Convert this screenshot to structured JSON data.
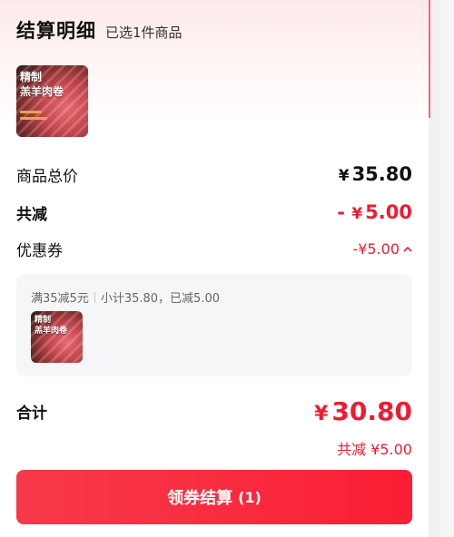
{
  "header": {
    "title": "结算明细",
    "subtitle": "已选1件商品"
  },
  "product": {
    "image_text_line1": "精制",
    "image_text_line2": "羔羊肉卷"
  },
  "summary": {
    "goods_total_label": "商品总价",
    "goods_total_currency": "¥",
    "goods_total_value": "35.80",
    "total_discount_label": "共减",
    "total_discount_prefix": "-",
    "total_discount_currency": "¥",
    "total_discount_value": "5.00",
    "coupon_label": "优惠券",
    "coupon_value": "-¥5.00",
    "coupon_expand_icon": "chevron-up-icon"
  },
  "coupon_detail": {
    "rule": "满35减5元",
    "subtotal_text": "小计35.80，已减5.00"
  },
  "total": {
    "label": "合计",
    "currency": "¥",
    "value": "30.80",
    "saving_text": "共减 ¥5.00"
  },
  "cta": {
    "label": "领券结算",
    "count": "(1)"
  },
  "colors": {
    "accent": "#ee1c33",
    "cta_start": "#f73a4a",
    "cta_end": "#fb1e35",
    "panel_bg": "#f5f6f8"
  }
}
